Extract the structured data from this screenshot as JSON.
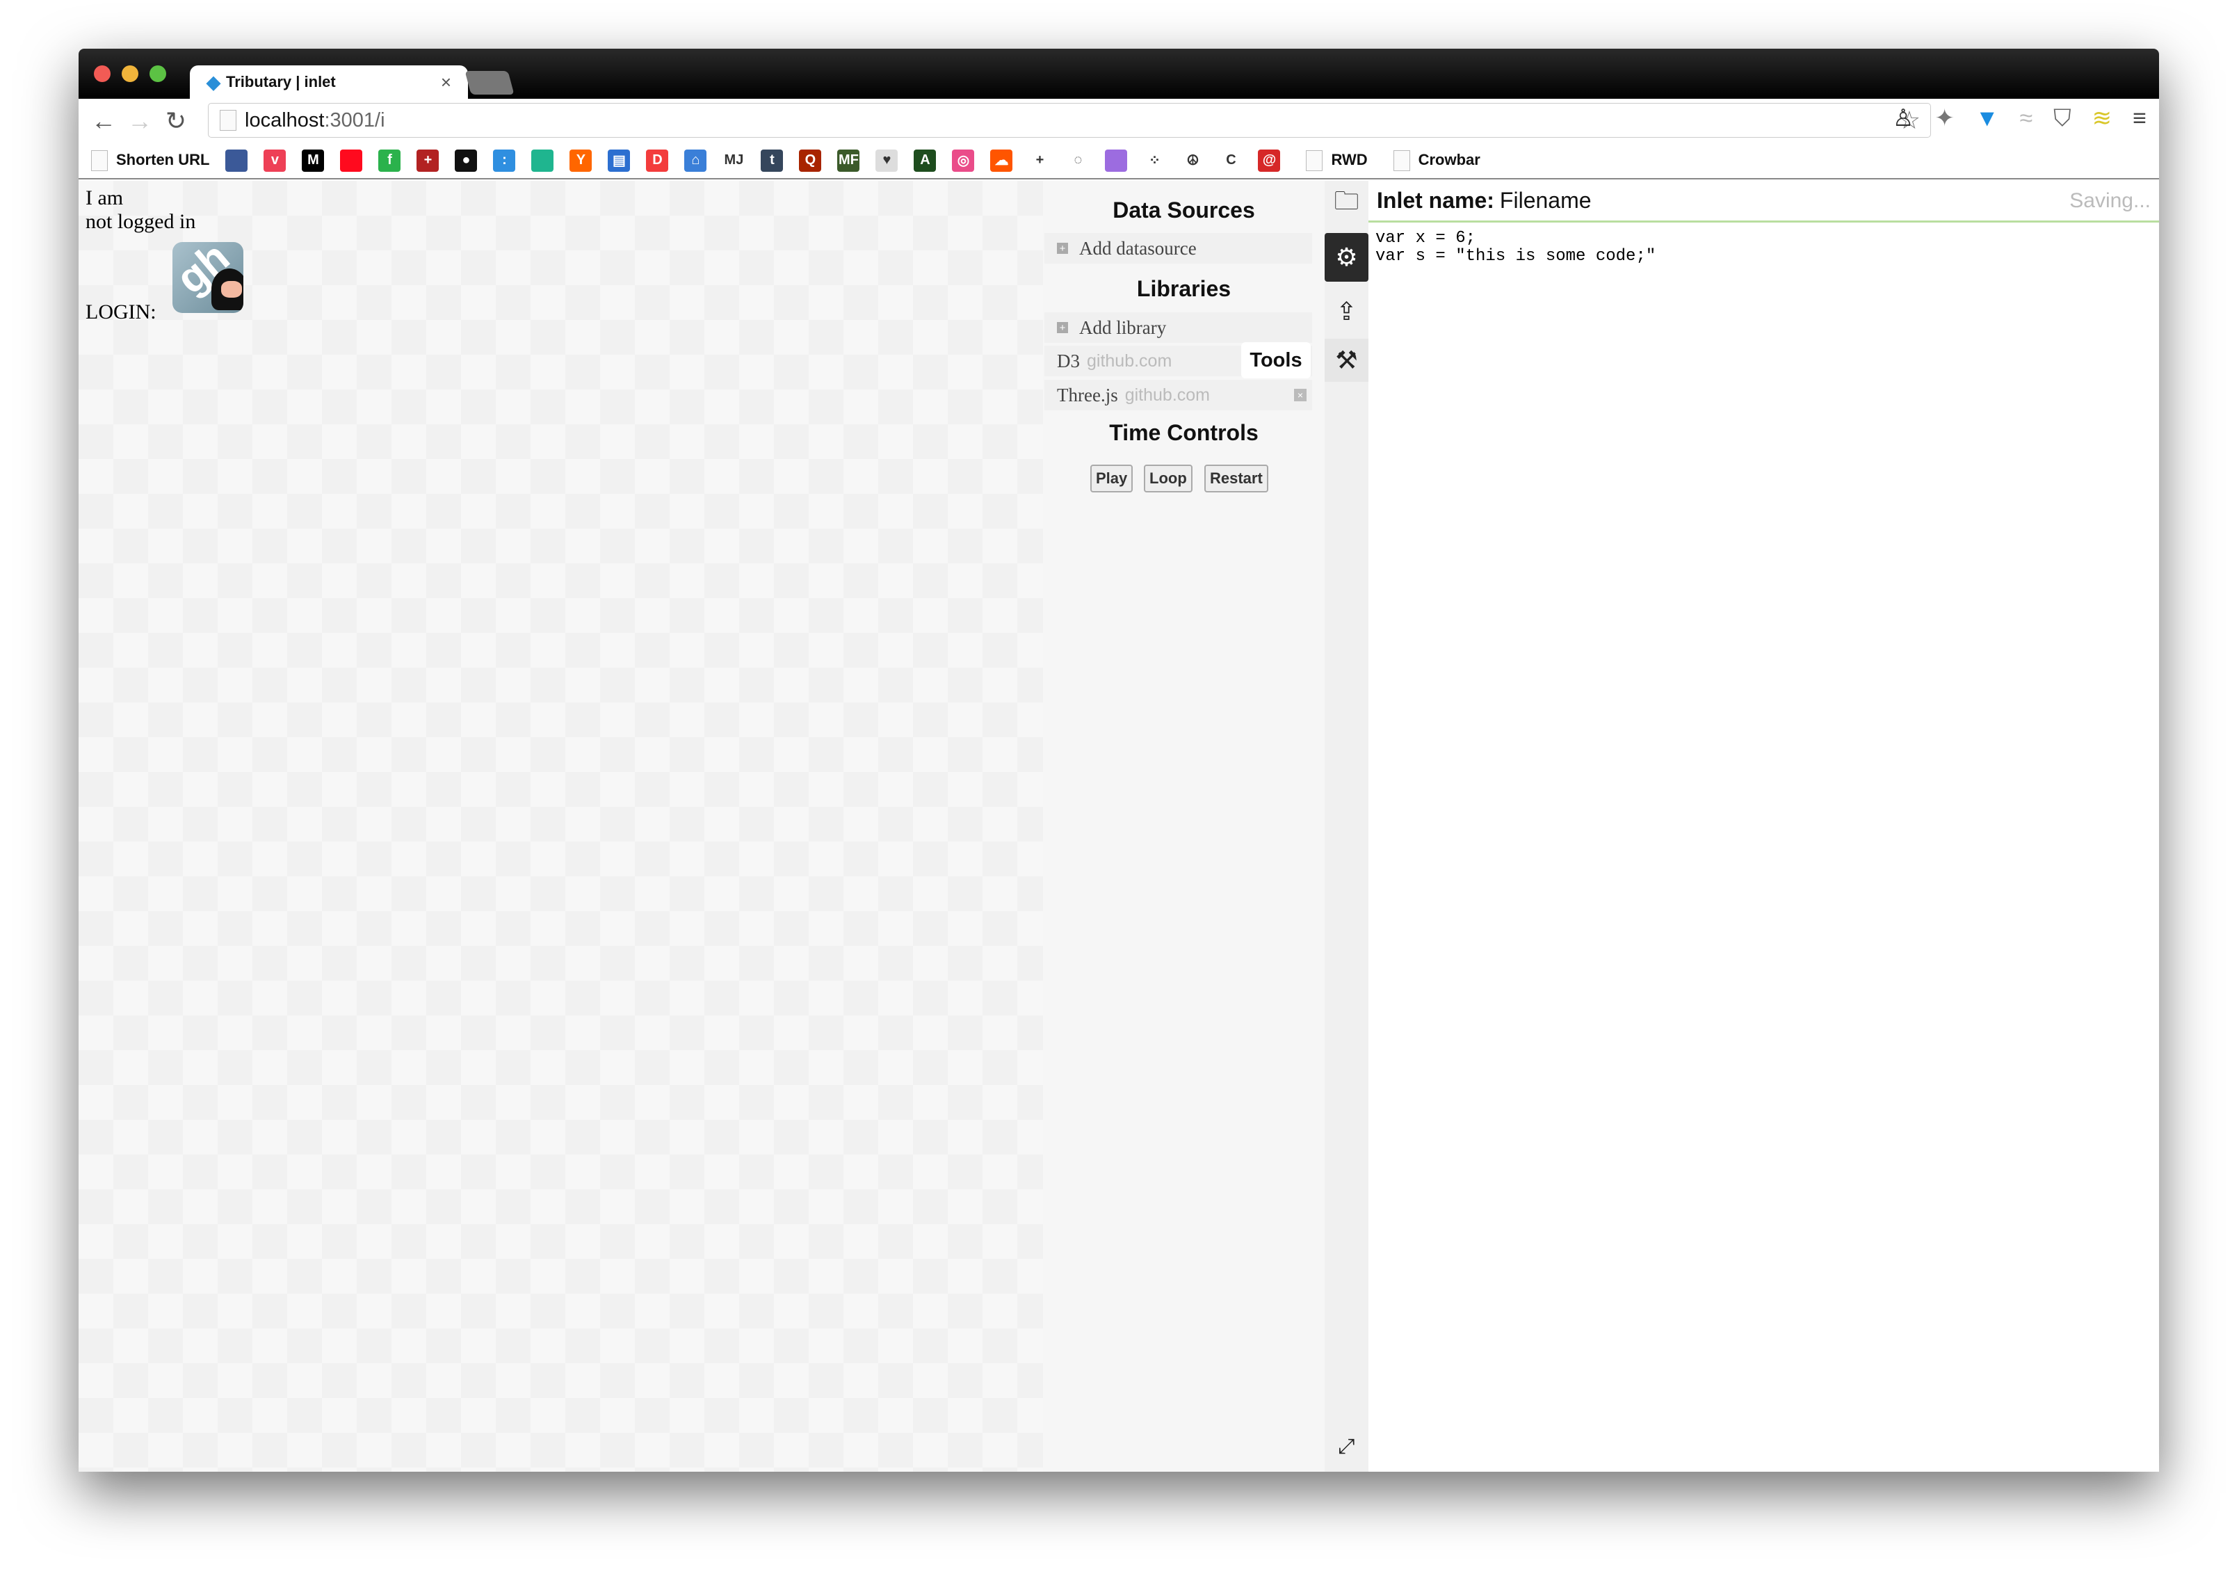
{
  "browser": {
    "tab_title": "Tributary | inlet",
    "tab_close": "×",
    "url_host": "localhost",
    "url_path": ":3001/i",
    "bookmarks": [
      {
        "label": "Shorten URL",
        "type": "page"
      },
      {
        "icon": "book-icon",
        "color": "#3b5998",
        "glyph": ""
      },
      {
        "icon": "pocket-icon",
        "color": "#ee4056",
        "glyph": "v"
      },
      {
        "icon": "medium-icon",
        "color": "#000000",
        "glyph": "M"
      },
      {
        "icon": "red-square-icon",
        "color": "#ff0a1e",
        "glyph": ""
      },
      {
        "icon": "feedly-icon",
        "color": "#2bb24c",
        "glyph": "f"
      },
      {
        "icon": "clock-cross-icon",
        "color": "#b22222",
        "glyph": "+"
      },
      {
        "icon": "github-icon",
        "color": "#111111",
        "glyph": "●"
      },
      {
        "icon": "dots-icon",
        "color": "#2f8fe0",
        "glyph": ":"
      },
      {
        "icon": "columns-icon",
        "color": "#1fb58f",
        "glyph": ""
      },
      {
        "icon": "ycombinator-icon",
        "color": "#ff6600",
        "glyph": "Y"
      },
      {
        "icon": "news-icon",
        "color": "#2c6fd0",
        "glyph": "▤"
      },
      {
        "icon": "d-icon",
        "color": "#f33c3c",
        "glyph": "D"
      },
      {
        "icon": "bookmark-icon",
        "color": "#3a7fd8",
        "glyph": "⌂"
      },
      {
        "icon": "mj-icon",
        "color": "#ffffff",
        "glyph": "MJ"
      },
      {
        "icon": "tumblr-icon",
        "color": "#35465c",
        "glyph": "t"
      },
      {
        "icon": "quora-icon",
        "color": "#a82400",
        "glyph": "Q"
      },
      {
        "icon": "mf-icon",
        "color": "#3b5a2a",
        "glyph": "MF"
      },
      {
        "icon": "heart-icon",
        "color": "#dddddd",
        "glyph": "♥"
      },
      {
        "icon": "a-icon",
        "color": "#1e4d1e",
        "glyph": "A"
      },
      {
        "icon": "dribbble-icon",
        "color": "#ea4c89",
        "glyph": "◎"
      },
      {
        "icon": "soundcloud-icon",
        "color": "#ff5500",
        "glyph": "☁"
      },
      {
        "icon": "plus-dots-icon",
        "color": "#ffffff",
        "glyph": "+"
      },
      {
        "icon": "circle-net-icon",
        "color": "#ffffff",
        "glyph": "◌"
      },
      {
        "icon": "rainbow-icon",
        "color": "#9c6ce0",
        "glyph": ""
      },
      {
        "icon": "nodes-icon",
        "color": "#ffffff",
        "glyph": "⁘"
      },
      {
        "icon": "peace-icon",
        "color": "#ffffff",
        "glyph": "☮"
      },
      {
        "icon": "c-icon",
        "color": "#ffffff",
        "glyph": "C"
      },
      {
        "icon": "mail-icon",
        "color": "#d62828",
        "glyph": "@"
      },
      {
        "label": "RWD",
        "type": "page"
      },
      {
        "label": "Crowbar",
        "type": "page"
      }
    ]
  },
  "login": {
    "line1": "I am",
    "line2": "not logged in",
    "login_label": "LOGIN:",
    "logo_text": "gh"
  },
  "panel": {
    "data_sources_title": "Data Sources",
    "add_datasource": "Add datasource",
    "libraries_title": "Libraries",
    "add_library": "Add library",
    "libraries": [
      {
        "name": "D3",
        "source": "github.com"
      },
      {
        "name": "Three.js",
        "source": "github.com"
      }
    ],
    "tooltip": "Tools",
    "time_controls_title": "Time Controls",
    "buttons": {
      "play": "Play",
      "loop": "Loop",
      "restart": "Restart"
    }
  },
  "editor": {
    "name_label": "Inlet name:",
    "name_value": "Filename",
    "status": "Saving...",
    "code": "var x = 6;\nvar s = \"this is some code;\""
  },
  "colors": {
    "accent_line": "#b9dea0",
    "tab_icon": "#2a8fd8"
  }
}
